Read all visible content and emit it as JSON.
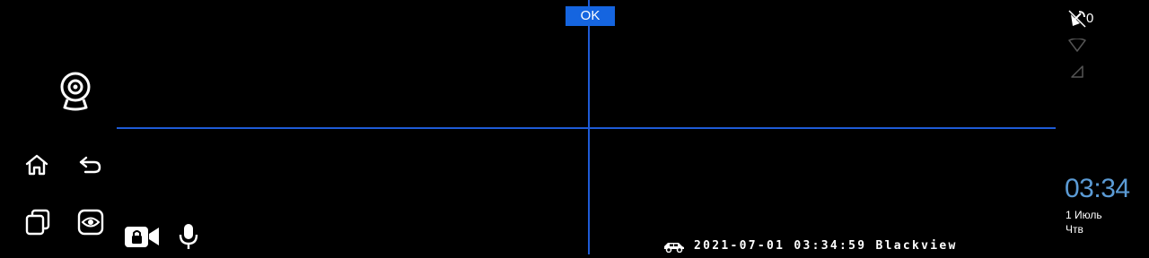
{
  "overlay": {
    "ok_label": "OK",
    "osd_text": "2021-07-01 03:34:59 Blackview"
  },
  "status": {
    "gps_satellites": "0",
    "time": "03:34",
    "date": "1 Июль",
    "weekday": "Чтв"
  },
  "icons": {
    "camera": "webcam-icon",
    "home": "home-icon",
    "back": "back-icon",
    "recents": "recent-apps-icon",
    "view": "eye-icon",
    "record": "locked-video-icon",
    "mic": "microphone-icon",
    "car": "car-icon",
    "gps": "satellite-icon",
    "wifi": "wifi-icon",
    "signal": "cellular-signal-icon"
  },
  "colors": {
    "crosshair": "#1e5bd6",
    "ok_background": "#1565e0",
    "clock": "#5b9bd5",
    "background": "#000000"
  }
}
